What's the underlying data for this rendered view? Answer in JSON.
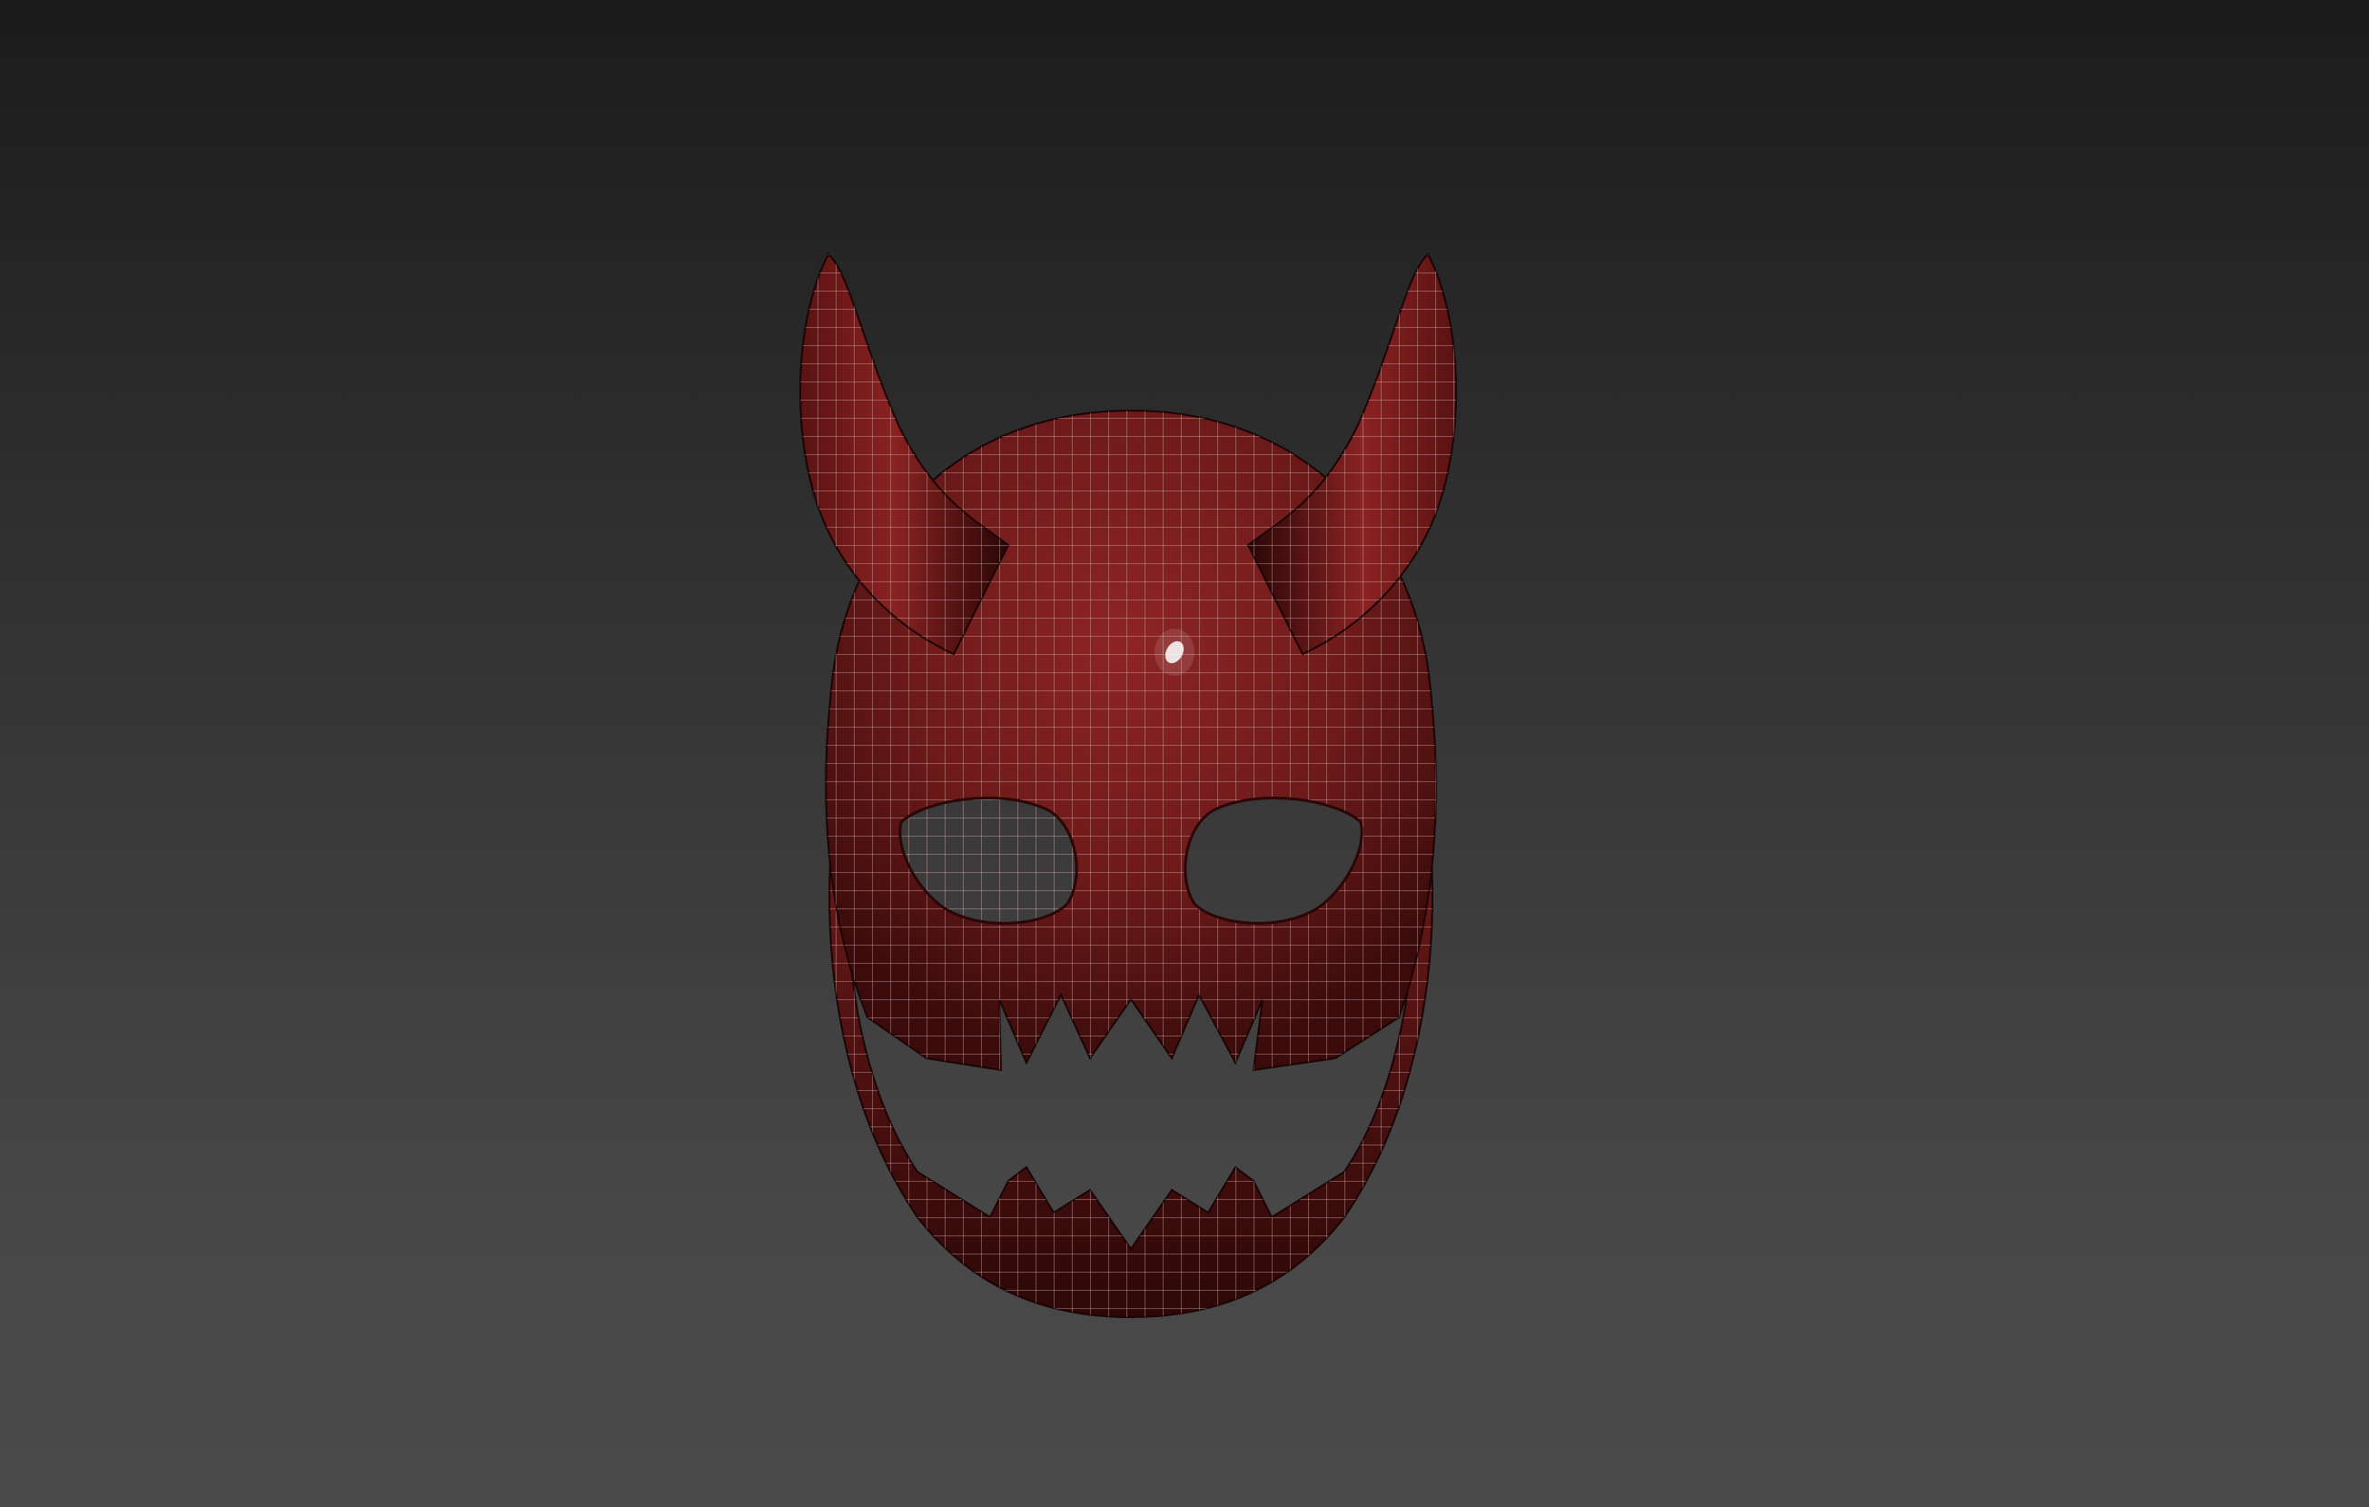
{
  "viewport": {
    "background_top": "#1b1b1b",
    "background_bottom": "#4a4a4a"
  },
  "model": {
    "subject": "devil-mask",
    "base_color": "#7a1c1c",
    "shade_color": "#3a0a0a",
    "highlight_color": "#b03030",
    "wire_color": "#d9b3b3",
    "specular_color": "#ffffff"
  }
}
